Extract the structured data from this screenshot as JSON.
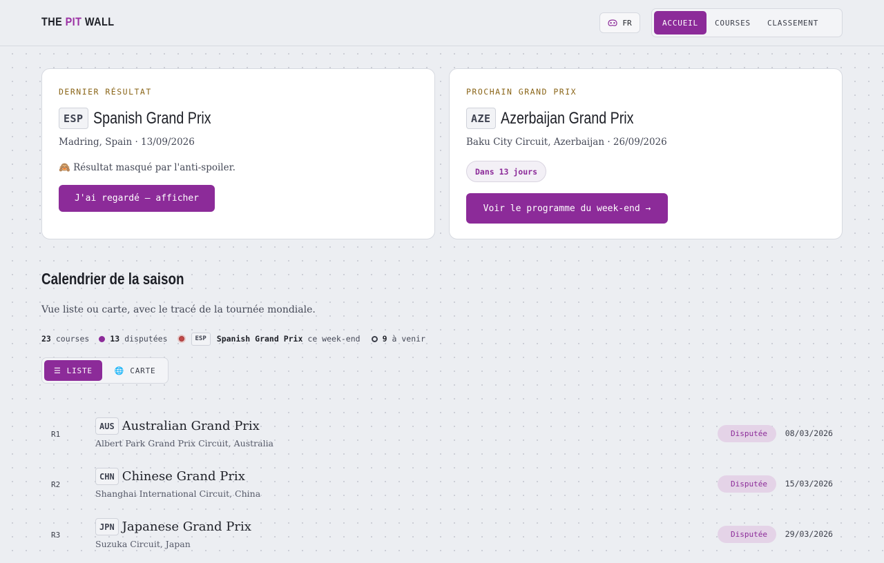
{
  "header": {
    "logo": {
      "part1": "THE ",
      "part2": "PIT",
      "part3": " WALL"
    },
    "lang_label": "FR",
    "lang_icon": "spoiler-mask-icon",
    "nav": [
      {
        "label": "ACCUEIL",
        "active": true
      },
      {
        "label": "COURSES",
        "active": false
      },
      {
        "label": "CLASSEMENT",
        "active": false
      }
    ]
  },
  "last_result": {
    "kicker": "DERNIER RÉSULTAT",
    "code": "ESP",
    "name": "Spanish Grand Prix",
    "meta": "Madring, Spain · 13/09/2026",
    "spoiler_text": "🙈 Résultat masqué par l'anti-spoiler.",
    "button": "J'ai regardé — afficher"
  },
  "next_gp": {
    "kicker": "PROCHAIN GRAND PRIX",
    "code": "AZE",
    "name": "Azerbaijan Grand Prix",
    "meta": "Baku City Circuit, Azerbaijan · 26/09/2026",
    "countdown": "Dans 13 jours",
    "button": "Voir le programme du week-end →"
  },
  "season": {
    "title": "Calendrier de la saison",
    "subtitle": "Vue liste ou carte, avec le tracé de la tournée mondiale.",
    "stats": {
      "total": "23",
      "total_label": "courses",
      "done": "13",
      "done_label": "disputées",
      "live_code": "ESP",
      "live_name": "Spanish Grand Prix",
      "live_label": "ce week-end",
      "upcoming": "9",
      "upcoming_label": "à venir"
    },
    "view_toggle": {
      "list_icon": "☰",
      "list_label": "LISTE",
      "map_icon": "🌐",
      "map_label": "CARTE"
    },
    "races": [
      {
        "round": "R1",
        "code": "AUS",
        "name": "Australian Grand Prix",
        "circuit": "Albert Park Grand Prix Circuit, Australia",
        "status": "Disputée",
        "date": "08/03/2026"
      },
      {
        "round": "R2",
        "code": "CHN",
        "name": "Chinese Grand Prix",
        "circuit": "Shanghai International Circuit, China",
        "status": "Disputée",
        "date": "15/03/2026"
      },
      {
        "round": "R3",
        "code": "JPN",
        "name": "Japanese Grand Prix",
        "circuit": "Suzuka Circuit, Japan",
        "status": "Disputée",
        "date": "29/03/2026"
      }
    ]
  }
}
